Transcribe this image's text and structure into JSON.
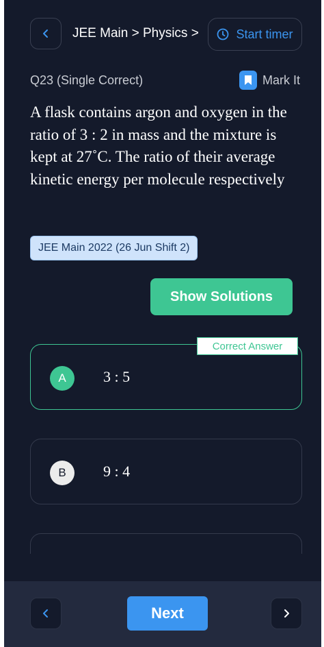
{
  "header": {
    "breadcrumb": "JEE Main > Physics > K",
    "timer_label": "Start timer"
  },
  "question": {
    "label": "Q23 (Single Correct)",
    "mark_label": "Mark It",
    "text": "A flask contains argon and oxygen in the ratio of 3 : 2 in mass and the mixture is kept at 27˚C. The ratio of their average kinetic energy per molecule respectively",
    "tag": "JEE Main 2022 (26 Jun Shift 2)"
  },
  "actions": {
    "show_solutions": "Show Solutions",
    "next": "Next"
  },
  "correct_label": "Correct Answer",
  "options": [
    {
      "letter": "A",
      "text": "3 : 5",
      "correct": true
    },
    {
      "letter": "B",
      "text": "9 : 4",
      "correct": false
    }
  ],
  "colors": {
    "background": "#141a2b",
    "accent_blue": "#3b95f0",
    "accent_green": "#3ec693",
    "bottom_bar": "#232a3e"
  }
}
